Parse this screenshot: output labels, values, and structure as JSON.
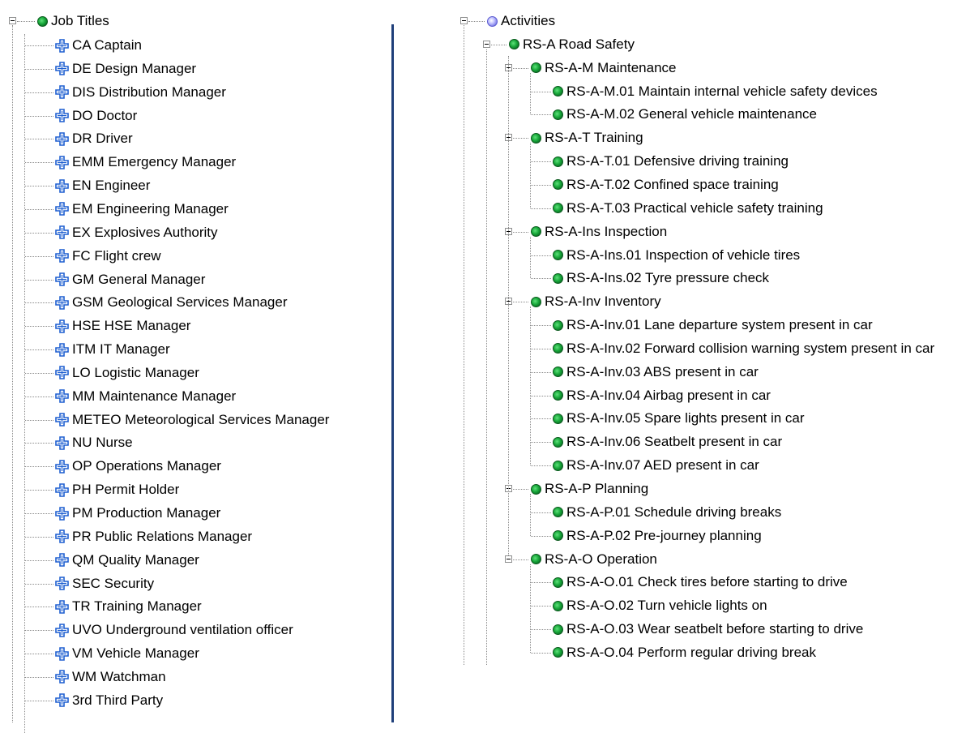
{
  "job_titles": {
    "root_label": "Job Titles",
    "items": [
      "CA Captain",
      "DE Design Manager",
      "DIS Distribution Manager",
      "DO Doctor",
      "DR Driver",
      "EMM Emergency Manager",
      "EN Engineer",
      "EM Engineering Manager",
      "EX Explosives Authority",
      "FC Flight crew",
      "GM General Manager",
      "GSM Geological Services Manager",
      "HSE HSE Manager",
      "ITM IT Manager",
      "LO Logistic Manager",
      "MM Maintenance Manager",
      "METEO Meteorological Services Manager",
      "NU Nurse",
      "OP Operations Manager",
      "PH Permit Holder",
      "PM Production Manager",
      "PR Public Relations Manager",
      "QM Quality Manager",
      "SEC Security",
      "TR Training Manager",
      "UVO Underground ventilation officer",
      "VM Vehicle Manager",
      "WM Watchman",
      "3rd Third Party"
    ]
  },
  "activities": {
    "root_label": "Activities",
    "group": {
      "label": "RS-A Road Safety",
      "categories": [
        {
          "label": "RS-A-M Maintenance",
          "items": [
            "RS-A-M.01 Maintain internal vehicle safety devices",
            "RS-A-M.02 General vehicle maintenance"
          ]
        },
        {
          "label": "RS-A-T Training",
          "items": [
            "RS-A-T.01 Defensive driving training",
            "RS-A-T.02 Confined space training",
            "RS-A-T.03 Practical vehicle safety training"
          ]
        },
        {
          "label": "RS-A-Ins Inspection",
          "items": [
            "RS-A-Ins.01 Inspection of vehicle tires",
            "RS-A-Ins.02 Tyre pressure check"
          ]
        },
        {
          "label": "RS-A-Inv Inventory",
          "items": [
            "RS-A-Inv.01 Lane departure system present in car",
            "RS-A-Inv.02 Forward collision warning system present in car",
            "RS-A-Inv.03 ABS present in car",
            "RS-A-Inv.04 Airbag present in car",
            "RS-A-Inv.05 Spare lights present in car",
            "RS-A-Inv.06 Seatbelt present in car",
            "RS-A-Inv.07 AED present in car"
          ]
        },
        {
          "label": "RS-A-P Planning",
          "items": [
            "RS-A-P.01 Schedule driving breaks",
            "RS-A-P.02 Pre-journey planning"
          ]
        },
        {
          "label": "RS-A-O Operation",
          "items": [
            "RS-A-O.01 Check tires before starting to drive",
            "RS-A-O.02 Turn vehicle lights on",
            "RS-A-O.03 Wear seatbelt before starting to drive",
            "RS-A-O.04 Perform regular driving break"
          ]
        }
      ]
    }
  },
  "colors": {
    "splitter": "#1f3f7a",
    "status_green": "#18a83a",
    "activities_blue": "#6b6be0",
    "cross_blue": "#1e5fd0"
  },
  "icons": {
    "expander": "collapse-box-icon",
    "status": "green-dot-icon",
    "activities_root": "blue-dot-icon",
    "job_title": "blue-cross-icon"
  }
}
